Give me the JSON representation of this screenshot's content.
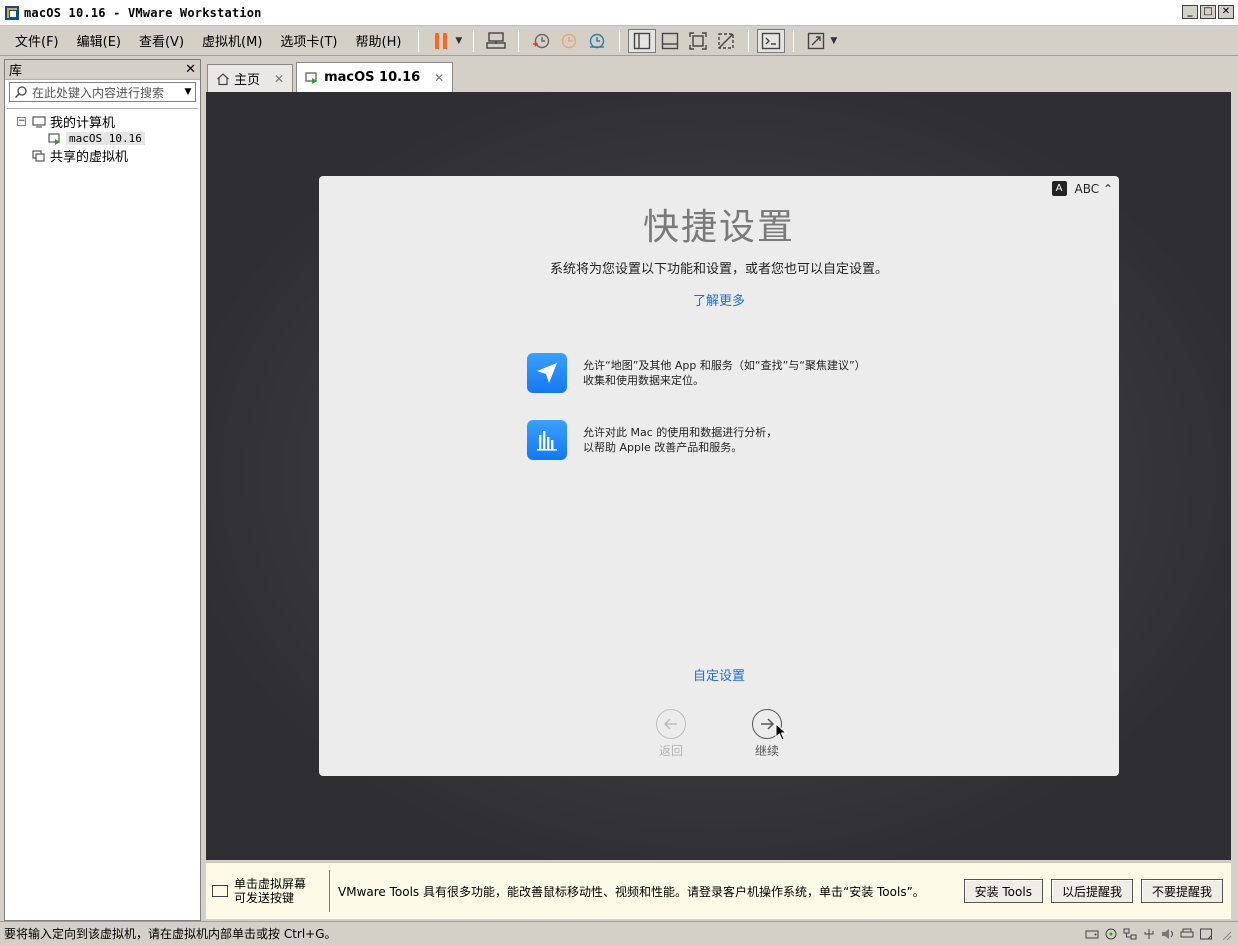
{
  "window": {
    "title": "macOS 10.16 - VMware Workstation",
    "minimize": "_",
    "maximize": "□",
    "close": "✕"
  },
  "menu": [
    "文件(F)",
    "编辑(E)",
    "查看(V)",
    "虚拟机(M)",
    "选项卡(T)",
    "帮助(H)"
  ],
  "toolbar": {
    "icons": [
      "pause-icon",
      "send-ctrl-alt-del-icon",
      "snapshot-icon",
      "revert-snapshot-icon",
      "snapshot-manager-icon",
      "show-library-icon",
      "show-thumbnail-icon",
      "full-screen-icon",
      "unity-icon",
      "console-view-icon",
      "stretch-icon"
    ],
    "accent": "#f26d21"
  },
  "library": {
    "title": "库",
    "close": "✕",
    "search_placeholder": "在此处键入内容进行搜索",
    "tree": {
      "root_label": "我的计算机",
      "root_expander": "−",
      "vm_label": "macOS 10.16",
      "shared_label": "共享的虚拟机"
    }
  },
  "tabs": [
    {
      "label": "主页",
      "close": "✕"
    },
    {
      "label": "macOS 10.16",
      "close": "✕"
    }
  ],
  "setup": {
    "keyboard_badge": "A",
    "keyboard_label": "ABC ⌃",
    "title": "快捷设置",
    "subtitle": "系统将为您设置以下功能和设置，或者您也可以自定设置。",
    "learn_more": "了解更多",
    "features": [
      {
        "line1": "允许“地图”及其他 App 和服务（如“查找”与“聚焦建议”）",
        "line2": "收集和使用数据来定位。"
      },
      {
        "line1": "允许对此 Mac 的使用和数据进行分析，",
        "line2": "以帮助 Apple 改善产品和服务。"
      }
    ],
    "customize": "自定设置",
    "back": "返回",
    "continue": "继续",
    "accent": "#1f6dd8"
  },
  "notification": {
    "hint_line1": "单击虚拟屏幕",
    "hint_line2": "可发送按键",
    "message": "VMware Tools 具有很多功能，能改善鼠标移动性、视频和性能。请登录客户机操作系统，单击“安装 Tools”。",
    "install": "安装 Tools",
    "remind_later": "以后提醒我",
    "never_remind": "不要提醒我"
  },
  "status": {
    "text": "要将输入定向到该虚拟机，请在虚拟机内部单击或按 Ctrl+G。"
  }
}
